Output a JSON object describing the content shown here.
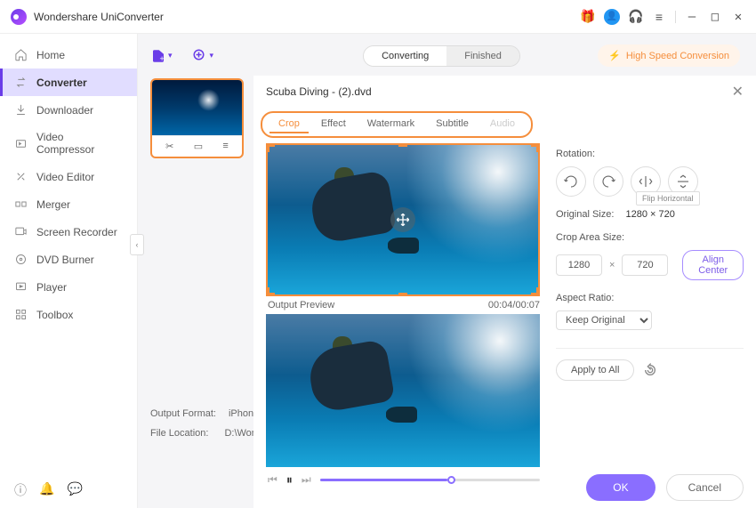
{
  "app": {
    "title": "Wondershare UniConverter"
  },
  "titlebar": {
    "gift_icon": "gift",
    "user_icon": "user",
    "headset_icon": "support",
    "menu_icon": "menu",
    "minimize": "—",
    "maximize": "□",
    "close": "✕"
  },
  "sidebar": {
    "items": [
      {
        "label": "Home",
        "icon": "home"
      },
      {
        "label": "Converter",
        "icon": "convert"
      },
      {
        "label": "Downloader",
        "icon": "download"
      },
      {
        "label": "Video Compressor",
        "icon": "compress"
      },
      {
        "label": "Video Editor",
        "icon": "editor"
      },
      {
        "label": "Merger",
        "icon": "merge"
      },
      {
        "label": "Screen Recorder",
        "icon": "recorder"
      },
      {
        "label": "DVD Burner",
        "icon": "dvd"
      },
      {
        "label": "Player",
        "icon": "player"
      },
      {
        "label": "Toolbox",
        "icon": "toolbox"
      }
    ],
    "collapse": "‹"
  },
  "toolbar": {
    "add_file": "+",
    "add_folder": "+",
    "seg_converting": "Converting",
    "seg_finished": "Finished",
    "hsc": "High Speed Conversion"
  },
  "file_card": {
    "trim": "✂",
    "crop": "▭",
    "more": "≡"
  },
  "content_info": {
    "output_format_label": "Output Format:",
    "output_format_value": "iPhone Xs, X",
    "file_location_label": "File Location:",
    "file_location_value": "D:\\Wonders"
  },
  "editor": {
    "title": "Scuba Diving - (2).dvd",
    "tabs": {
      "crop": "Crop",
      "effect": "Effect",
      "watermark": "Watermark",
      "subtitle": "Subtitle",
      "audio": "Audio"
    },
    "preview_label": "Output Preview",
    "time": "00:04/00:07",
    "controls": {
      "rotation_label": "Rotation:",
      "rotate_left": "90°",
      "rotate_right": "90°",
      "flip_h_tooltip": "Flip Horizontal",
      "orig_size_label": "Original Size:",
      "orig_size_value": "1280 × 720",
      "crop_area_label": "Crop Area Size:",
      "crop_w": "1280",
      "crop_h": "720",
      "mult": "×",
      "align_center": "Align Center",
      "aspect_label": "Aspect Ratio:",
      "aspect_value": "Keep Original",
      "apply_all": "Apply to All"
    },
    "footer": {
      "ok": "OK",
      "cancel": "Cancel"
    }
  }
}
